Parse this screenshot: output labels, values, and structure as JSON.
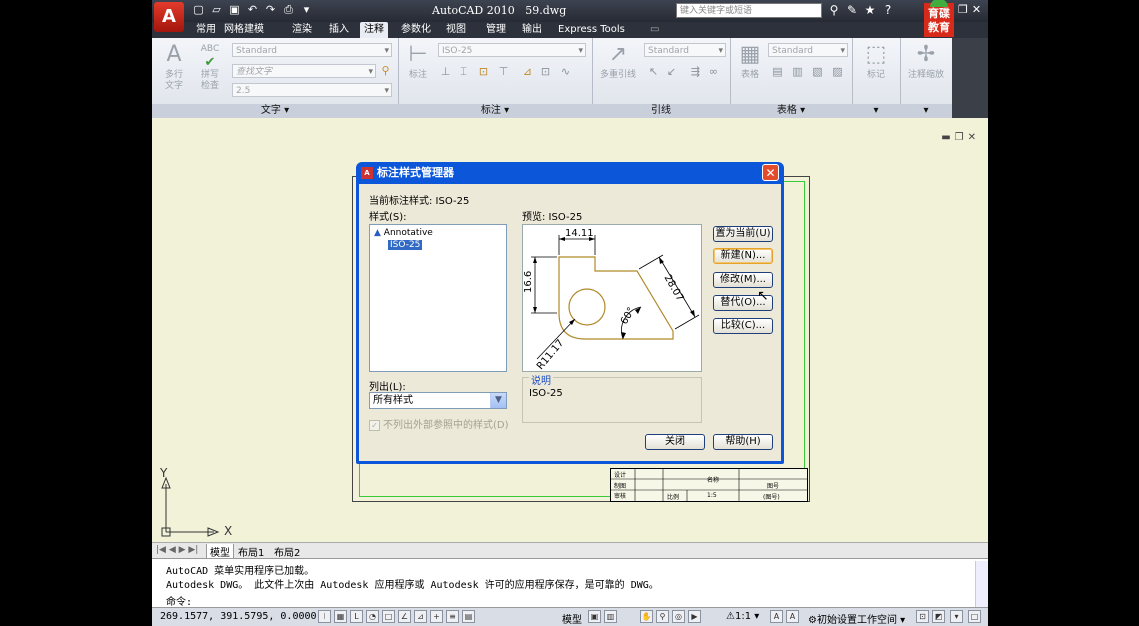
{
  "window": {
    "app_title": "AutoCAD 2010",
    "file_name": "59.dwg",
    "search_placeholder": "键入关键字或短语",
    "logo_letter": "A",
    "brand_line1": "育碟",
    "brand_line2": "教育"
  },
  "tabs": [
    "常用",
    "网格建模",
    "渲染",
    "插入",
    "注释",
    "参数化",
    "视图",
    "管理",
    "输出",
    "Express Tools"
  ],
  "active_tab": "注释",
  "ribbon": {
    "text_panel": {
      "label": "文字",
      "multiline_text": "多行\n文字",
      "spell_check": "拼写\n检查",
      "abc": "ABC",
      "text_style": "Standard",
      "find_text": "查找文字",
      "height": "2.5"
    },
    "dim_panel": {
      "label": "标注",
      "dim_button": "标注",
      "dim_style": "ISO-25"
    },
    "leader_panel": {
      "label": "引线",
      "multileader": "多重引线",
      "leader_style": "Standard"
    },
    "table_panel": {
      "label": "表格",
      "table_button": "表格",
      "table_style": "Standard"
    },
    "markup_panel": {
      "button": "标记"
    },
    "scale_panel": {
      "button": "注释缩放"
    }
  },
  "dialog": {
    "title": "标注样式管理器",
    "current_style_label": "当前标注样式: ISO-25",
    "styles_label": "样式(S):",
    "styles": [
      "Annotative",
      "ISO-25"
    ],
    "selected_style": "ISO-25",
    "preview_label": "预览: ISO-25",
    "list_label": "列出(L):",
    "list_value": "所有样式",
    "exclude_xref_label": "不列出外部参照中的样式(D)",
    "description_title": "说明",
    "description_text": "ISO-25",
    "buttons": {
      "set_current": "置为当前(U)",
      "new": "新建(N)...",
      "modify": "修改(M)...",
      "override": "替代(O)...",
      "compare": "比较(C)...",
      "close": "关闭",
      "help": "帮助(H)"
    },
    "preview_dims": {
      "top": "14.11",
      "left": "16.6",
      "slant": "28.07",
      "angle": "60°",
      "radius": "R11.17"
    }
  },
  "layout_tabs": [
    "模型",
    "布局1",
    "布局2"
  ],
  "command": {
    "line1": "AutoCAD 菜单实用程序已加载。",
    "line2": "Autodesk DWG。  此文件上次由 Autodesk 应用程序或 Autodesk 许可的应用程序保存，是可靠的 DWG。",
    "prompt": "命令:"
  },
  "status": {
    "coordinates": "269.1577, 391.5795, 0.0000",
    "model_label": "模型",
    "scale": "1:1",
    "workspace": "初始设置工作空间"
  },
  "axis": {
    "x": "X",
    "y": "Y"
  },
  "titleblock": {
    "c1": "设计",
    "c2": "制图",
    "c3": "审核",
    "c4": "比例",
    "c5": "1:5",
    "c6": "名称",
    "c7": "图号",
    "c8": "(图号)"
  },
  "colors": {
    "dialog_frame": "#0b56d9",
    "drawing_bg": "#f2f2d9",
    "sheet_border": "#3aca3a",
    "preview_lines": "#b08a2a"
  }
}
